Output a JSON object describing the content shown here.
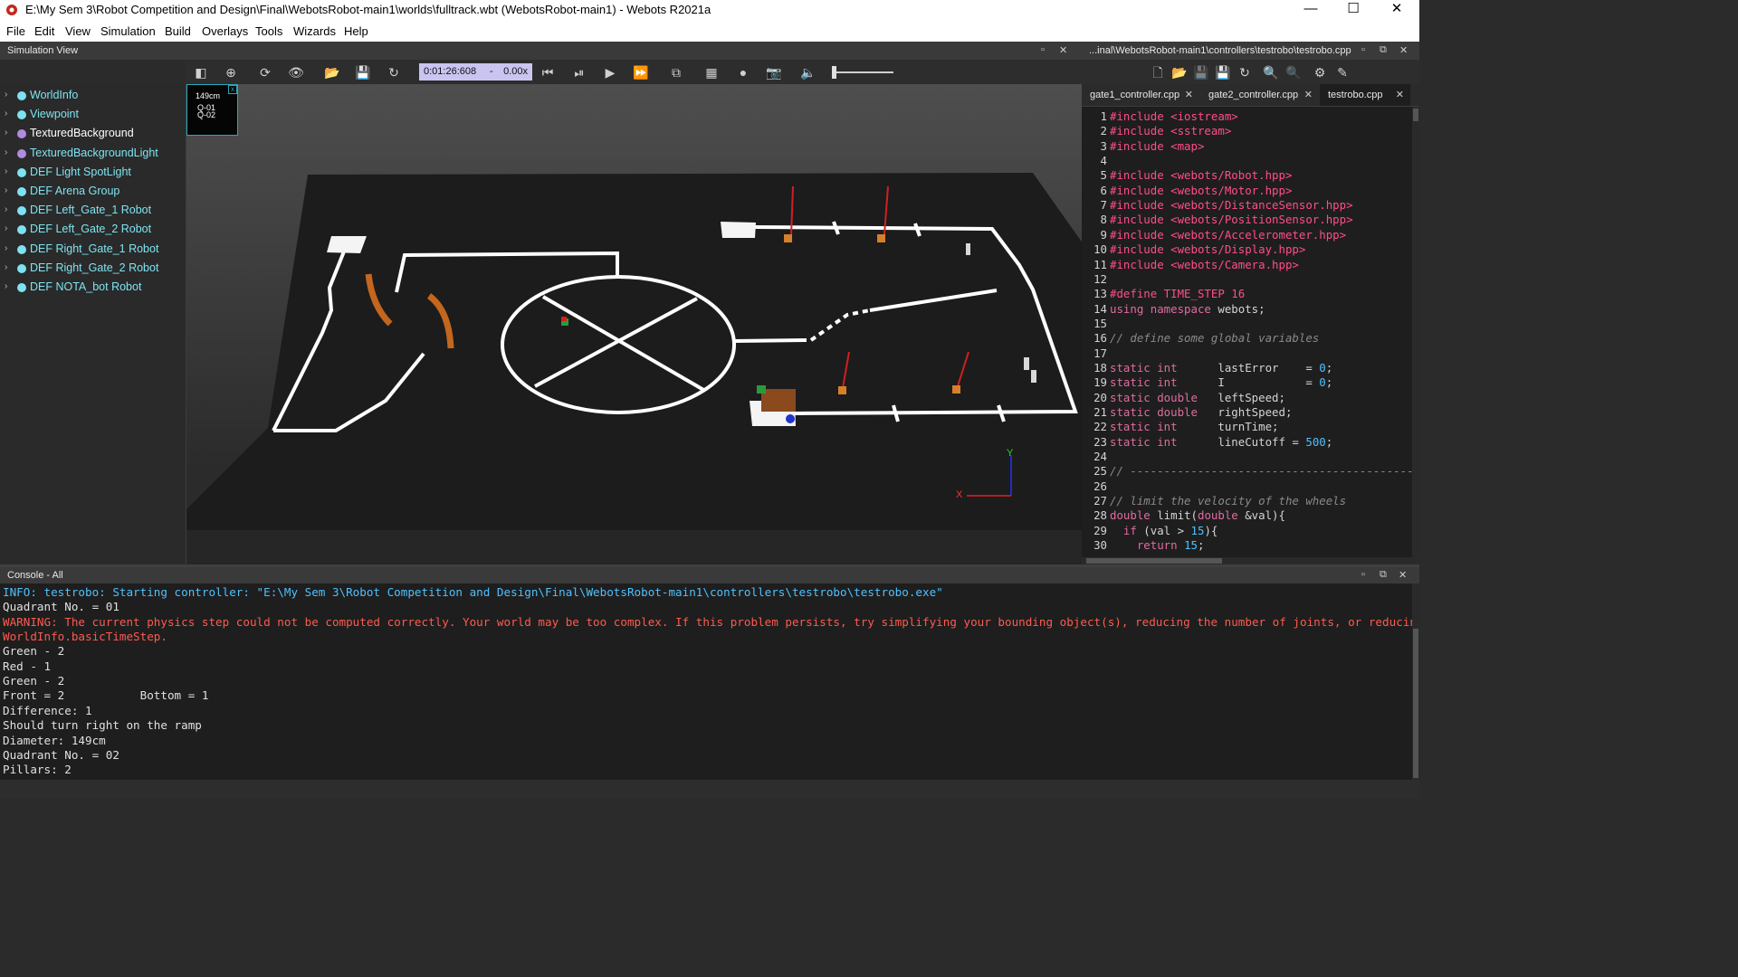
{
  "window": {
    "title": "E:\\My Sem 3\\Robot Competition and Design\\Final\\WebotsRobot-main1\\worlds\\fulltrack.wbt (WebotsRobot-main1) - Webots R2021a",
    "minimize": "—",
    "maximize": "☐",
    "close": "✕"
  },
  "menu": [
    "File",
    "Edit",
    "View",
    "Simulation",
    "Build",
    "Overlays",
    "Tools",
    "Wizards",
    "Help"
  ],
  "simulation_view": {
    "title": "Simulation View",
    "time": "0:01:26:608",
    "time_sep": "-",
    "speed": "0.00x"
  },
  "scene_tree": [
    {
      "label": "WorldInfo",
      "color": "#7ee3f0",
      "text_color": "#7ee3f0"
    },
    {
      "label": "Viewpoint",
      "color": "#7ee3f0",
      "text_color": "#7ee3f0"
    },
    {
      "label": "TexturedBackground",
      "color": "#b18be0",
      "text_color": "#ffffff"
    },
    {
      "label": "TexturedBackgroundLight",
      "color": "#b18be0",
      "text_color": "#7ee3f0"
    },
    {
      "label": "DEF Light SpotLight",
      "color": "#7ee3f0",
      "text_color": "#7ee3f0"
    },
    {
      "label": "DEF Arena Group",
      "color": "#7ee3f0",
      "text_color": "#7ee3f0"
    },
    {
      "label": "DEF Left_Gate_1 Robot",
      "color": "#7ee3f0",
      "text_color": "#7ee3f0"
    },
    {
      "label": "DEF Left_Gate_2 Robot",
      "color": "#7ee3f0",
      "text_color": "#7ee3f0"
    },
    {
      "label": "DEF Right_Gate_1 Robot",
      "color": "#7ee3f0",
      "text_color": "#7ee3f0"
    },
    {
      "label": "DEF Right_Gate_2 Robot",
      "color": "#7ee3f0",
      "text_color": "#7ee3f0"
    },
    {
      "label": "DEF NOTA_bot Robot",
      "color": "#7ee3f0",
      "text_color": "#7ee3f0"
    }
  ],
  "display_overlay": {
    "diameter": "149cm",
    "q1": "Q-01",
    "q2": "Q-02"
  },
  "axes": {
    "y": "Y",
    "x": "X"
  },
  "editor": {
    "path": "...inal\\WebotsRobot-main1\\controllers\\testrobo\\testrobo.cpp",
    "tabs": [
      {
        "label": "gate1_controller.cpp",
        "close": "✕"
      },
      {
        "label": "gate2_controller.cpp",
        "close": "✕"
      },
      {
        "label": "testrobo.cpp",
        "close": "✕"
      }
    ],
    "lines": [
      {
        "n": "1",
        "segs": [
          {
            "t": "#include <iostream>",
            "c": "pp"
          }
        ]
      },
      {
        "n": "2",
        "segs": [
          {
            "t": "#include <sstream>",
            "c": "pp"
          }
        ]
      },
      {
        "n": "3",
        "segs": [
          {
            "t": "#include <map>",
            "c": "pp"
          }
        ]
      },
      {
        "n": "4",
        "segs": []
      },
      {
        "n": "5",
        "segs": [
          {
            "t": "#include <webots/Robot.hpp>",
            "c": "pp"
          }
        ]
      },
      {
        "n": "6",
        "segs": [
          {
            "t": "#include <webots/Motor.hpp>",
            "c": "pp"
          }
        ]
      },
      {
        "n": "7",
        "segs": [
          {
            "t": "#include <webots/DistanceSensor.hpp>",
            "c": "pp"
          }
        ]
      },
      {
        "n": "8",
        "segs": [
          {
            "t": "#include <webots/PositionSensor.hpp>",
            "c": "pp"
          }
        ]
      },
      {
        "n": "9",
        "segs": [
          {
            "t": "#include <webots/Accelerometer.hpp>",
            "c": "pp"
          }
        ]
      },
      {
        "n": "10",
        "segs": [
          {
            "t": "#include <webots/Display.hpp>",
            "c": "pp"
          }
        ]
      },
      {
        "n": "11",
        "segs": [
          {
            "t": "#include <webots/Camera.hpp>",
            "c": "pp"
          }
        ]
      },
      {
        "n": "12",
        "segs": []
      },
      {
        "n": "13",
        "segs": [
          {
            "t": "#define TIME_STEP 16",
            "c": "pp"
          }
        ]
      },
      {
        "n": "14",
        "segs": [
          {
            "t": "using namespace",
            "c": "ty"
          },
          {
            "t": " webots;",
            "c": ""
          }
        ]
      },
      {
        "n": "15",
        "segs": []
      },
      {
        "n": "16",
        "segs": [
          {
            "t": "// define some global variables",
            "c": "cm"
          }
        ]
      },
      {
        "n": "17",
        "segs": []
      },
      {
        "n": "18",
        "segs": [
          {
            "t": "static int",
            "c": "ty"
          },
          {
            "t": "      lastError    = ",
            "c": ""
          },
          {
            "t": "0",
            "c": "nm"
          },
          {
            "t": ";",
            "c": ""
          }
        ]
      },
      {
        "n": "19",
        "segs": [
          {
            "t": "static int",
            "c": "ty"
          },
          {
            "t": "      I            = ",
            "c": ""
          },
          {
            "t": "0",
            "c": "nm"
          },
          {
            "t": ";",
            "c": ""
          }
        ]
      },
      {
        "n": "20",
        "segs": [
          {
            "t": "static double",
            "c": "ty"
          },
          {
            "t": "   leftSpeed;",
            "c": ""
          }
        ]
      },
      {
        "n": "21",
        "segs": [
          {
            "t": "static double",
            "c": "ty"
          },
          {
            "t": "   rightSpeed;",
            "c": ""
          }
        ]
      },
      {
        "n": "22",
        "segs": [
          {
            "t": "static int",
            "c": "ty"
          },
          {
            "t": "      turnTime;",
            "c": ""
          }
        ]
      },
      {
        "n": "23",
        "segs": [
          {
            "t": "static int",
            "c": "ty"
          },
          {
            "t": "      lineCutoff = ",
            "c": ""
          },
          {
            "t": "500",
            "c": "nm"
          },
          {
            "t": ";",
            "c": ""
          }
        ]
      },
      {
        "n": "24",
        "segs": []
      },
      {
        "n": "25",
        "segs": [
          {
            "t": "// -------------------------------------------------------",
            "c": "cm"
          }
        ]
      },
      {
        "n": "26",
        "segs": []
      },
      {
        "n": "27",
        "segs": [
          {
            "t": "// limit the velocity of the wheels",
            "c": "cm"
          }
        ]
      },
      {
        "n": "28",
        "segs": [
          {
            "t": "double",
            "c": "ty"
          },
          {
            "t": " limit(",
            "c": ""
          },
          {
            "t": "double",
            "c": "ty"
          },
          {
            "t": " &val){",
            "c": ""
          }
        ]
      },
      {
        "n": "29",
        "segs": [
          {
            "t": "  if",
            "c": "ty"
          },
          {
            "t": " (val > ",
            "c": ""
          },
          {
            "t": "15",
            "c": "nm"
          },
          {
            "t": "){",
            "c": ""
          }
        ]
      },
      {
        "n": "30",
        "segs": [
          {
            "t": "    return",
            "c": "ty"
          },
          {
            "t": " ",
            "c": ""
          },
          {
            "t": "15",
            "c": "nm"
          },
          {
            "t": ";",
            "c": ""
          }
        ]
      }
    ]
  },
  "console": {
    "title": "Console - All",
    "lines": [
      {
        "text": "INFO: testrobo: Starting controller: \"E:\\My Sem 3\\Robot Competition and Design\\Final\\WebotsRobot-main1\\controllers\\testrobo\\testrobo.exe\"",
        "color": "#4fc1ff"
      },
      {
        "text": "Quadrant No. = 01",
        "color": "#e0e0e0"
      },
      {
        "text": "WARNING: The current physics step could not be computed correctly. Your world may be too complex. If this problem persists, try simplifying your bounding object(s), reducing the number of joints, or reducing",
        "color": "#ff5a4f"
      },
      {
        "text": "WorldInfo.basicTimeStep.",
        "color": "#ff5a4f"
      },
      {
        "text": "Green - 2",
        "color": "#e0e0e0"
      },
      {
        "text": "Red - 1",
        "color": "#e0e0e0"
      },
      {
        "text": "Green - 2",
        "color": "#e0e0e0"
      },
      {
        "text": "Front = 2           Bottom = 1",
        "color": "#e0e0e0"
      },
      {
        "text": "Difference: 1",
        "color": "#e0e0e0"
      },
      {
        "text": "Should turn right on the ramp",
        "color": "#e0e0e0"
      },
      {
        "text": "Diameter: 149cm",
        "color": "#e0e0e0"
      },
      {
        "text": "Quadrant No. = 02",
        "color": "#e0e0e0"
      },
      {
        "text": "Pillars: 2",
        "color": "#e0e0e0"
      }
    ]
  }
}
